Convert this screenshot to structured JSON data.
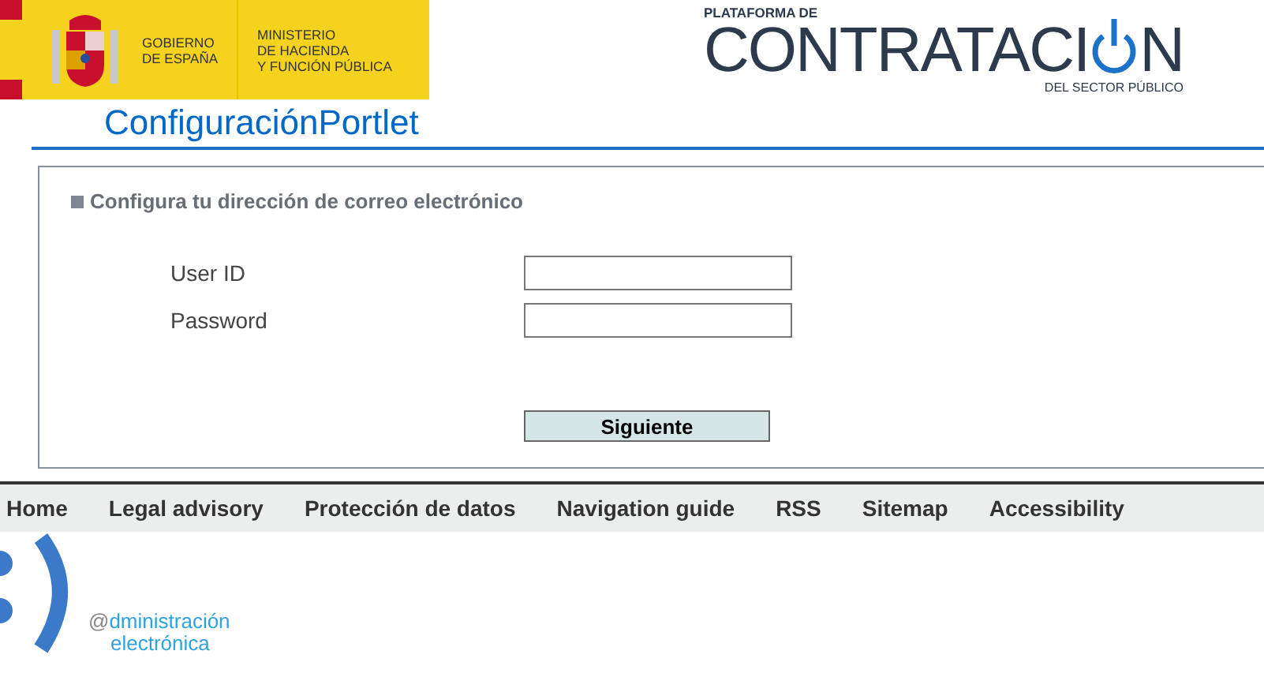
{
  "header": {
    "gov_logo": {
      "government": [
        "GOBIERNO",
        "DE ESPAÑA"
      ],
      "ministry": [
        "MINISTERIO",
        "DE HACIENDA",
        "Y FUNCIÓN PÚBLICA"
      ]
    },
    "platform_logo": {
      "top": "PLATAFORMA DE",
      "main": "CONTRATACI",
      "main_end": "N",
      "bottom": "DEL SECTOR PÚBLICO"
    }
  },
  "page_title": "ConfiguraciónPortlet",
  "form": {
    "heading": "Configura tu dirección de correo electrónico",
    "fields": [
      {
        "label": "User ID"
      },
      {
        "label": "Password"
      }
    ],
    "submit": "Siguiente"
  },
  "footer_nav": [
    "Home",
    "Legal advisory",
    "Protección de datos",
    "Navigation guide",
    "RSS",
    "Sitemap",
    "Accessibility"
  ],
  "footer_logo": {
    "at": "@",
    "line1": "dministración",
    "line2": "electrónica"
  }
}
